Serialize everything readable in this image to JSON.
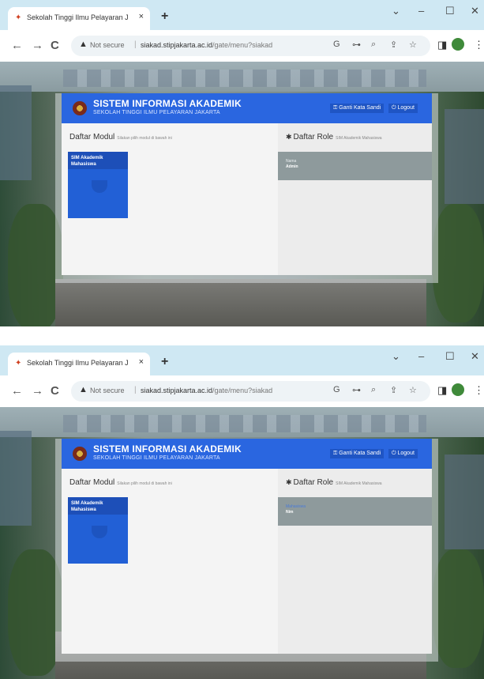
{
  "screens": [
    {
      "browser": {
        "tab_title": "Sekolah Tinggi Ilmu Pelayaran Ja",
        "tab_close": "×",
        "new_tab": "+",
        "window_controls": [
          "⌄",
          "–",
          "☐",
          "✕"
        ],
        "nav": [
          "←",
          "→",
          "C"
        ],
        "security_label": "Not secure",
        "url_host": "siakad.stipjakarta.ac.id",
        "url_path": "/gate/menu?siakad",
        "omni_icons": [
          "G",
          "⊶",
          "⌕",
          "⇪",
          "☆"
        ],
        "toolbar_icons": [
          "◨",
          "⋮"
        ]
      },
      "app": {
        "title": "SISTEM INFORMASI AKADEMIK",
        "subtitle": "SEKOLAH TINGGI ILMU PELAYARAN JAKARTA",
        "change_password": "Ganti Kata Sandi",
        "logout": "Logout",
        "modules_heading": "Daftar Modul",
        "modules_note": "Silakan pilih modul di bawah ini",
        "module_tile": "SIM Akademik Mahasiswa",
        "roles_heading": "Daftar Role",
        "roles_note": "SIM Akademik Mahasiswa",
        "role_line1": "Nama",
        "role_line2": "Admin"
      }
    },
    {
      "browser": {
        "tab_title": "Sekolah Tinggi Ilmu Pelayaran Ja",
        "tab_close": "×",
        "new_tab": "+",
        "window_controls": [
          "⌄",
          "–",
          "☐",
          "✕"
        ],
        "nav": [
          "←",
          "→",
          "C"
        ],
        "security_label": "Not secure",
        "url_host": "siakad.stipjakarta.ac.id",
        "url_path": "/gate/menu?siakad",
        "omni_icons": [
          "G",
          "⊶",
          "⌕",
          "⇪",
          "☆"
        ],
        "toolbar_icons": [
          "◨",
          "⋮"
        ]
      },
      "app": {
        "title": "SISTEM INFORMASI AKADEMIK",
        "subtitle": "SEKOLAH TINGGI ILMU PELAYARAN JAKARTA",
        "change_password": "Ganti Kata Sandi",
        "logout": "Logout",
        "modules_heading": "Daftar Modul",
        "modules_note": "Silakan pilih modul di bawah ini",
        "module_tile": "SIM Akademik Mahasiswa",
        "roles_heading": "Daftar Role",
        "roles_note": "SIM Akademik Mahasiswa",
        "role_line1": "Mahasiswa",
        "role_line2": "Nim"
      }
    }
  ]
}
